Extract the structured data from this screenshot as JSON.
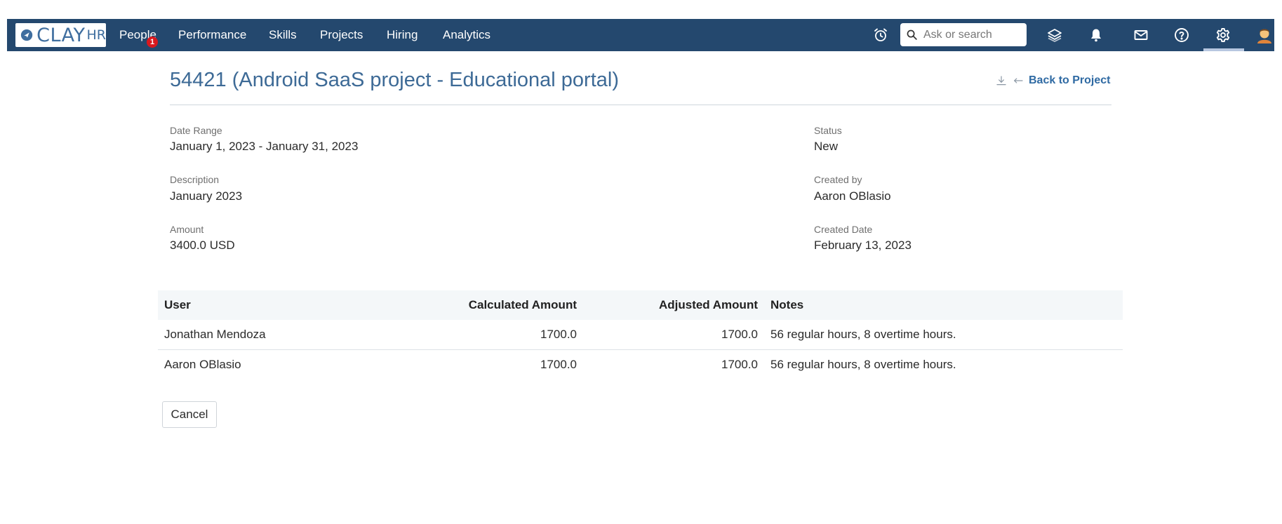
{
  "brand": {
    "logo_text": "CLAY",
    "logo_suffix": "HR"
  },
  "nav": {
    "items": [
      "People",
      "Performance",
      "Skills",
      "Projects",
      "Hiring",
      "Analytics"
    ],
    "people_badge": "1"
  },
  "search": {
    "placeholder": "Ask or search"
  },
  "toolbar_icons": [
    "alarm-clock-icon",
    "layers-icon",
    "bell-icon",
    "mail-icon",
    "help-icon",
    "gear-icon",
    "avatar"
  ],
  "page": {
    "title": "54421 (Android SaaS project - Educational portal)",
    "back_label": "Back to Project"
  },
  "details": {
    "date_range_label": "Date Range",
    "date_range_value": "January 1, 2023 - January 31, 2023",
    "description_label": "Description",
    "description_value": "January 2023",
    "amount_label": "Amount",
    "amount_value": "3400.0 USD",
    "status_label": "Status",
    "status_value": "New",
    "created_by_label": "Created by",
    "created_by_value": "Aaron OBlasio",
    "created_date_label": "Created Date",
    "created_date_value": "February 13, 2023"
  },
  "table": {
    "headers": [
      "User",
      "Calculated Amount",
      "Adjusted Amount",
      "Notes"
    ],
    "rows": [
      [
        "Jonathan Mendoza",
        "1700.0",
        "1700.0",
        "56 regular hours, 8 overtime hours."
      ],
      [
        "Aaron OBlasio",
        "1700.0",
        "1700.0",
        "56 regular hours, 8 overtime hours."
      ]
    ]
  },
  "actions": {
    "cancel_label": "Cancel"
  },
  "colors": {
    "topbar": "#24486e",
    "title": "#3d6a96",
    "link": "#2f6aa3",
    "badge": "#d9181e"
  }
}
